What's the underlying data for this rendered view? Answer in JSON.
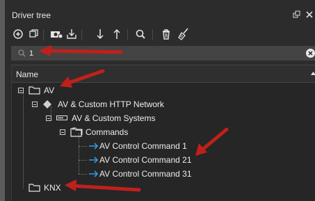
{
  "panel": {
    "title": "Driver tree"
  },
  "search": {
    "value": "1"
  },
  "tree": {
    "column_header": "Name",
    "nodes": [
      {
        "label": "AV"
      },
      {
        "label": "AV & Custom HTTP Network"
      },
      {
        "label": "AV & Custom Systems"
      },
      {
        "label": "Commands"
      },
      {
        "label": "AV Control Command 1"
      },
      {
        "label": "AV Control Command 21"
      },
      {
        "label": "AV Control Command 31"
      },
      {
        "label": "KNX"
      }
    ]
  },
  "colors": {
    "annotation_arrow": "#c0201c",
    "command_arrow": "#2e9be8",
    "background": "#2a2a2a"
  },
  "icons": [
    "float-window-icon",
    "close-panel-icon",
    "add-icon",
    "duplicate-icon",
    "camera-icon",
    "import-icon",
    "move-down-icon",
    "move-up-icon",
    "search-icon",
    "delete-icon",
    "clean-icon",
    "clear-search-icon",
    "sort-asc-icon",
    "folder-icon",
    "diamond-icon",
    "device-icon",
    "command-arrow-icon"
  ]
}
